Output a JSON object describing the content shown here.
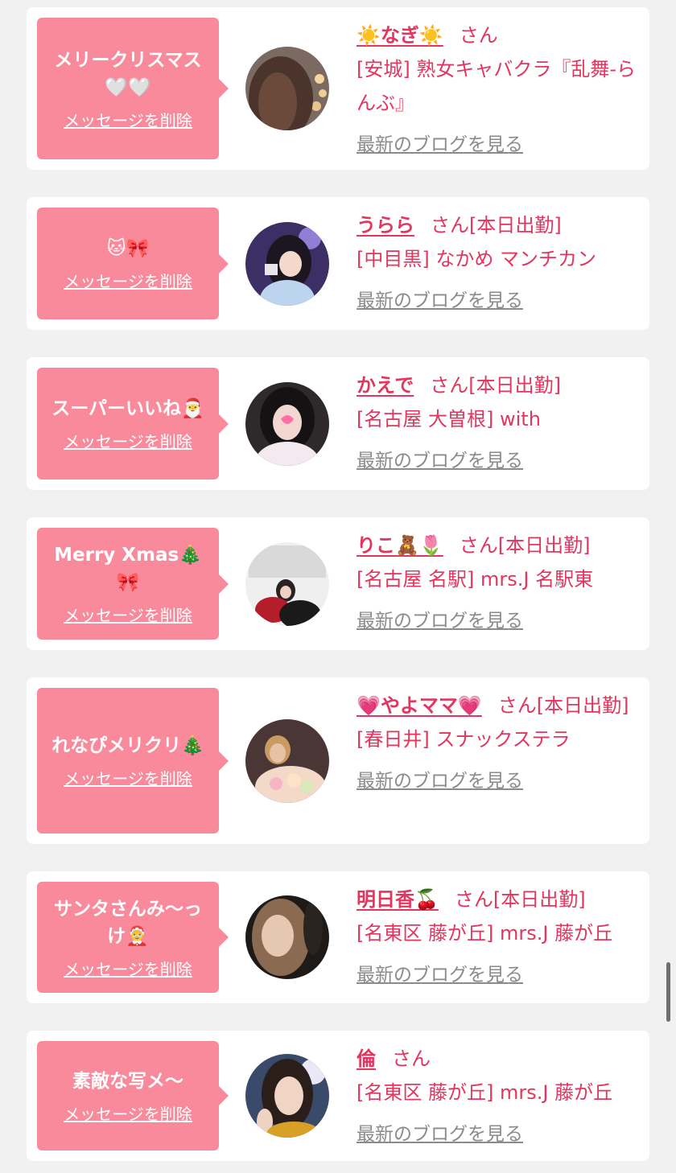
{
  "delete_label": "メッセージを削除",
  "blog_label": "最新のブログを見る",
  "items": [
    {
      "message": "メリークリスマス🤍🤍",
      "name": "☀️なぎ☀️",
      "honorific": "さん",
      "status": "",
      "shop": "[安城] 熟女キャバクラ『乱舞-らんぶ』"
    },
    {
      "message": "🐱🎀",
      "name": "うらら",
      "honorific": "さん",
      "status": "[本日出勤]",
      "shop": "[中目黒] なかめ マンチカン"
    },
    {
      "message": "スーパーいいね🎅",
      "name": "かえで",
      "honorific": "さん",
      "status": "[本日出勤]",
      "shop": "[名古屋 大曽根] with"
    },
    {
      "message": "Merry Xmas🎄🎀",
      "name": "りこ🧸🌷",
      "honorific": "さん",
      "status": "[本日出勤]",
      "shop": "[名古屋 名駅] mrs.J 名駅東"
    },
    {
      "message": "れなぴメリクリ🎄",
      "name": "💗やよママ💗",
      "honorific": "さん",
      "status": "[本日出勤]",
      "shop": "[春日井] スナックステラ"
    },
    {
      "message": "サンタさんみ〜っけ🤶",
      "name": "明日香🍒",
      "honorific": "さん",
      "status": "[本日出勤]",
      "shop": "[名東区 藤が丘] mrs.J 藤が丘"
    },
    {
      "message": "素敵な写メ〜",
      "name": "倫",
      "honorific": "さん",
      "status": "",
      "shop": "[名東区 藤が丘] mrs.J 藤が丘"
    }
  ],
  "colors": {
    "bubble": "#f88a9c",
    "accent": "#e2365e",
    "muted": "#8b8b8b",
    "background": "#f1f1f1"
  }
}
